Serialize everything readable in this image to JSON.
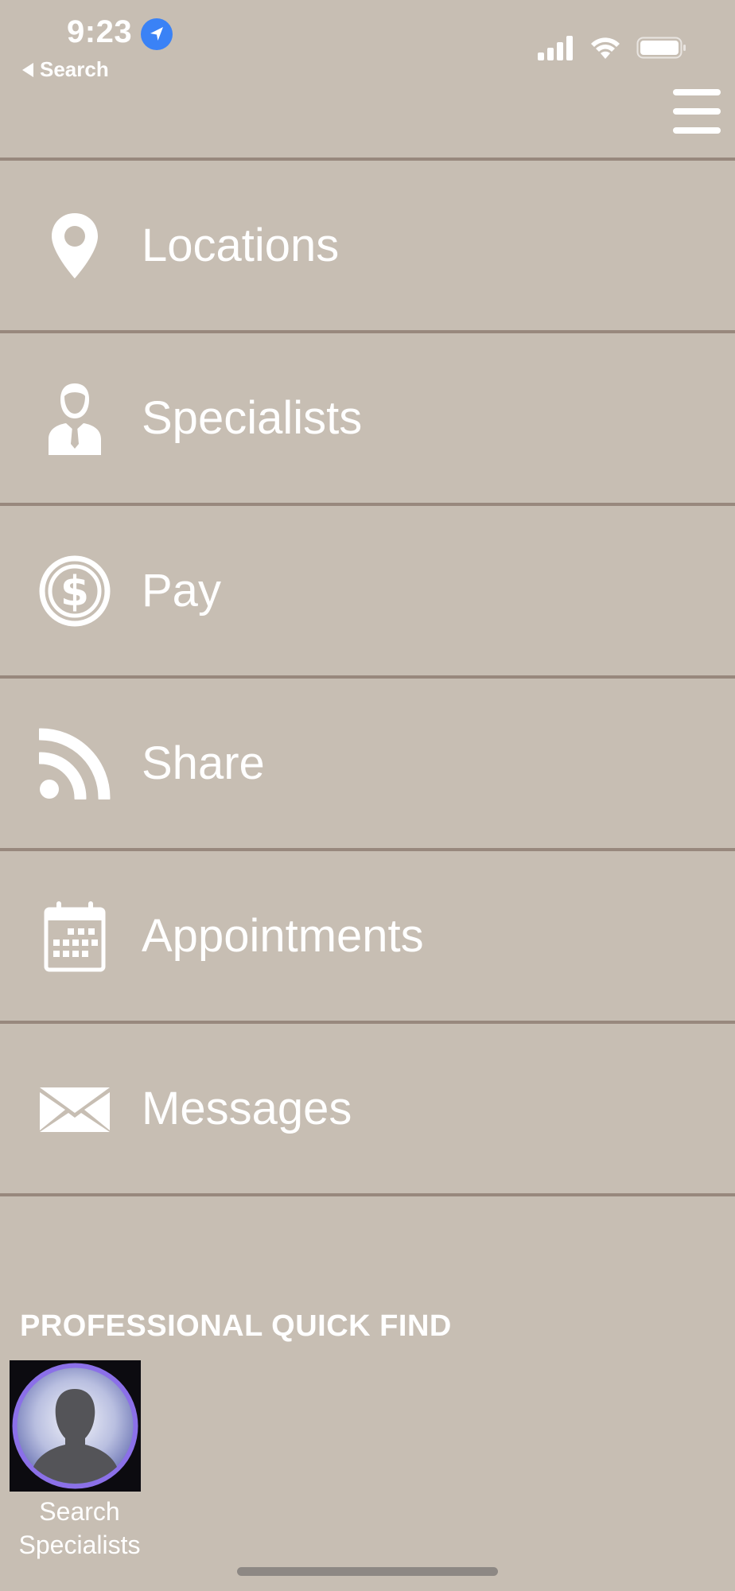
{
  "status_bar": {
    "time": "9:23",
    "back_label": "Search"
  },
  "menu": {
    "items": [
      {
        "label": "Locations",
        "icon": "map-pin-icon"
      },
      {
        "label": "Specialists",
        "icon": "person-icon"
      },
      {
        "label": "Pay",
        "icon": "dollar-coin-icon"
      },
      {
        "label": "Share",
        "icon": "rss-feed-icon"
      },
      {
        "label": "Appointments",
        "icon": "calendar-icon"
      },
      {
        "label": "Messages",
        "icon": "envelope-icon"
      }
    ]
  },
  "quick_find": {
    "title": "PROFESSIONAL QUICK FIND",
    "items": [
      {
        "line1": "Search",
        "line2": "Specialists",
        "icon": "avatar-silhouette-icon"
      }
    ]
  },
  "colors": {
    "background": "#c7beb3",
    "divider": "#98887d",
    "text": "#ffffff",
    "location_badge": "#3a82f6",
    "avatar_ring": "#8b70e8"
  }
}
